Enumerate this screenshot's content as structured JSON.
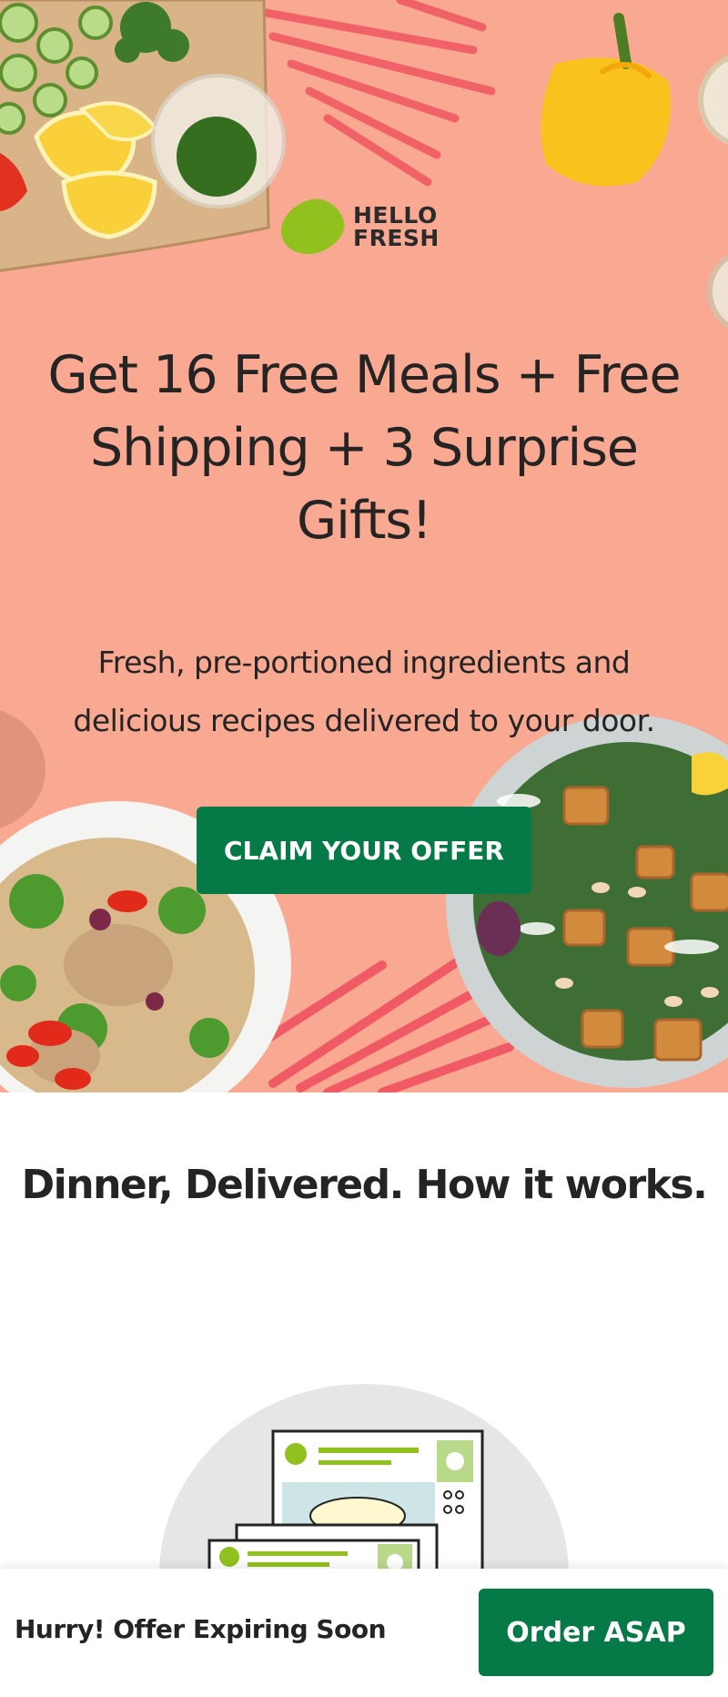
{
  "brand": {
    "logo_line1": "HELLO",
    "logo_line2": "FRESH"
  },
  "hero": {
    "headline": "Get 16 Free Meals + Free Shipping + 3 Surprise Gifts!",
    "subline": "Fresh, pre-portioned ingredients and delicious recipes delivered to your door.",
    "cta_label": "CLAIM YOUR OFFER"
  },
  "how_it_works": {
    "title": "Dinner, Delivered. How it works."
  },
  "sticky_bar": {
    "message": "Hurry! Offer Expiring Soon",
    "order_label": "Order ASAP"
  },
  "colors": {
    "hero_bg": "#f9a992",
    "accent_green": "#067a46",
    "brand_lime": "#91c11e",
    "stripe": "#f05a64"
  },
  "icons": [
    "hellofresh-lime-logo",
    "recipe-cards-illustration"
  ]
}
